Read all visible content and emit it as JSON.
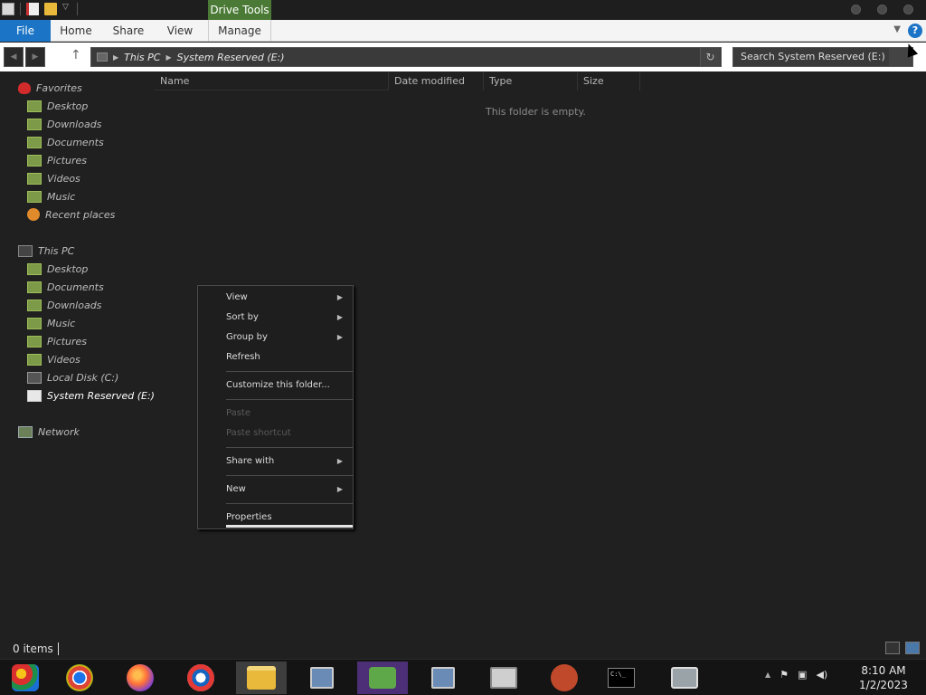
{
  "titlebar": {
    "contextual_tab": "Drive Tools"
  },
  "ribbon": {
    "tabs": [
      "File",
      "Home",
      "Share",
      "View",
      "Manage"
    ],
    "help": "?"
  },
  "address": {
    "crumbs": [
      "This PC",
      "System Reserved (E:)"
    ],
    "search_placeholder": "Search System Reserved (E:)"
  },
  "navpane": {
    "favorites": {
      "label": "Favorites",
      "items": [
        "Desktop",
        "Downloads",
        "Documents",
        "Pictures",
        "Videos",
        "Music",
        "Recent places"
      ]
    },
    "this_pc": {
      "label": "This PC",
      "items": [
        "Desktop",
        "Documents",
        "Downloads",
        "Music",
        "Pictures",
        "Videos",
        "Local Disk (C:)",
        "System Reserved (E:)"
      ]
    },
    "network": {
      "label": "Network"
    }
  },
  "columns": [
    "Name",
    "Date modified",
    "Type",
    "Size"
  ],
  "empty_message": "This folder is empty.",
  "context_menu": {
    "items": [
      {
        "label": "View",
        "submenu": true,
        "enabled": true
      },
      {
        "label": "Sort by",
        "submenu": true,
        "enabled": true
      },
      {
        "label": "Group by",
        "submenu": true,
        "enabled": true
      },
      {
        "label": "Refresh",
        "submenu": false,
        "enabled": true
      },
      {
        "label": "Customize this folder...",
        "submenu": false,
        "enabled": true
      },
      {
        "label": "Paste",
        "submenu": false,
        "enabled": false
      },
      {
        "label": "Paste shortcut",
        "submenu": false,
        "enabled": false
      },
      {
        "label": "Share with",
        "submenu": true,
        "enabled": true
      },
      {
        "label": "New",
        "submenu": true,
        "enabled": true
      },
      {
        "label": "Properties",
        "submenu": false,
        "enabled": true
      }
    ]
  },
  "statusbar": {
    "count": "0 items"
  },
  "taskbar": {
    "apps": [
      "start-icon",
      "chrome-icon",
      "firefox-icon",
      "ie-icon",
      "file-explorer-icon",
      "remote-desktop-icon",
      "people-icon",
      "network-setup-icon",
      "archive-icon",
      "bird-app-icon",
      "command-prompt-icon",
      "disk-tool-icon"
    ],
    "cmd_glyph": "C:\\_",
    "time": "8:10 AM",
    "date": "1/2/2023"
  },
  "colors": {
    "file_tab": "#1b74c5",
    "contextual_tab": "#4a7a35",
    "background": "#202020"
  }
}
